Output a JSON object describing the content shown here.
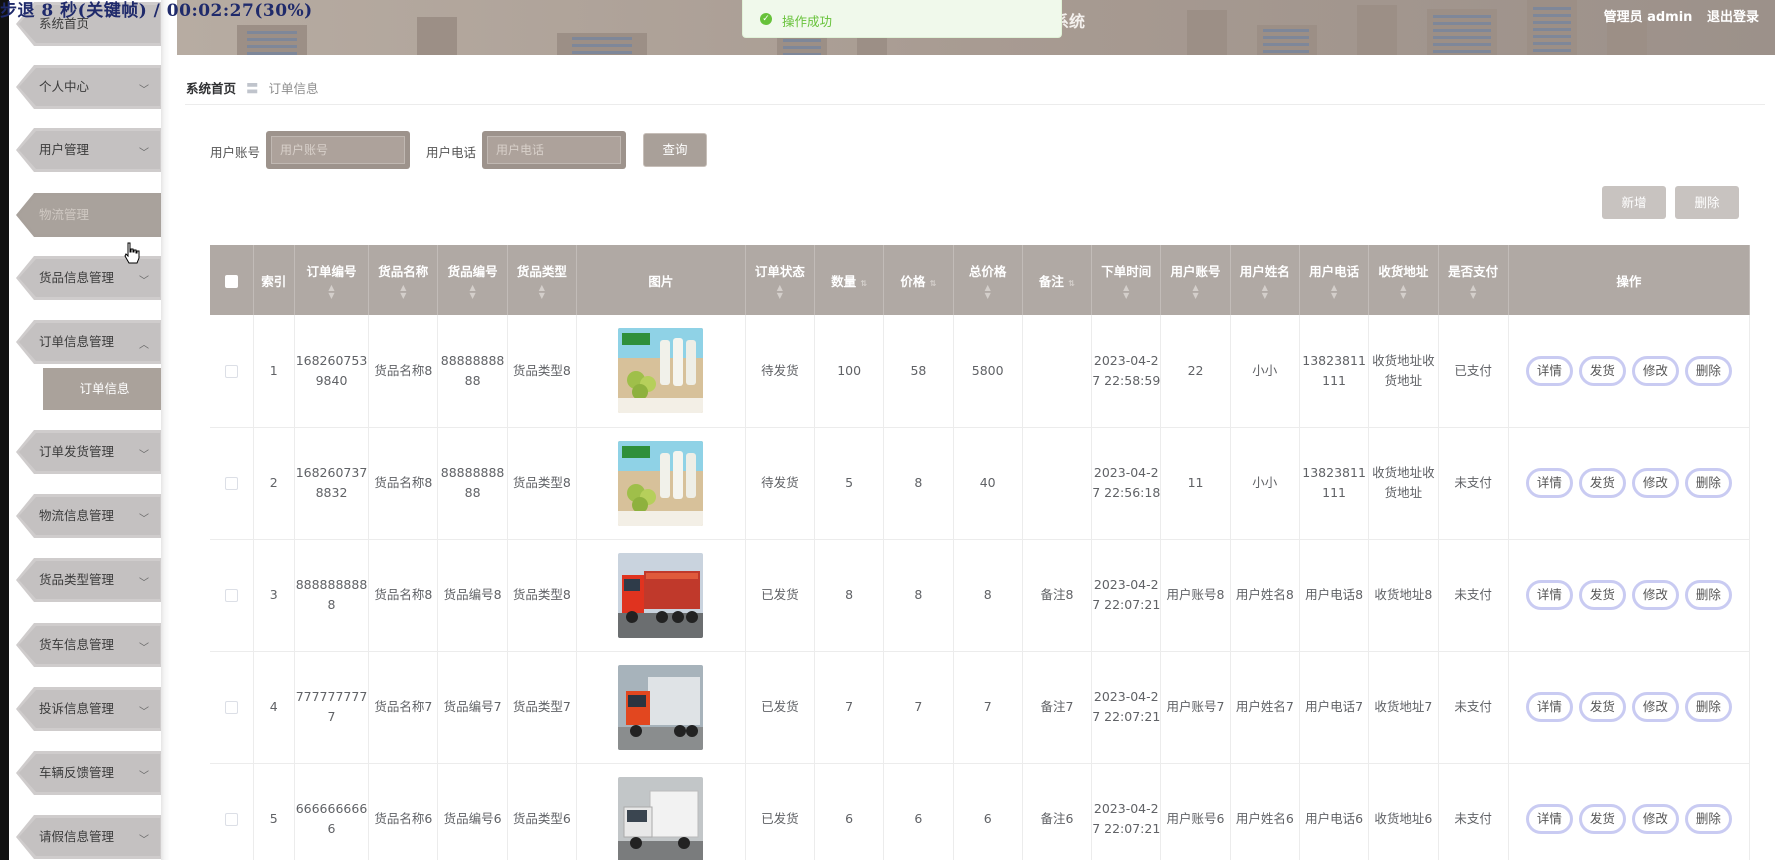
{
  "overlay": {
    "text": "步退 8 秒(关键帧) / 00:02:27(30%)"
  },
  "toast": {
    "message": "操作成功"
  },
  "header": {
    "title": "理系统",
    "user_label": "管理员 admin",
    "logout_label": "退出登录"
  },
  "sidebar": {
    "items": [
      {
        "label": "系统首页"
      },
      {
        "label": "个人中心"
      },
      {
        "label": "用户管理"
      },
      {
        "label": "物流管理"
      },
      {
        "label": "货品信息管理"
      },
      {
        "label": "订单信息管理"
      },
      {
        "label": "订单发货管理"
      },
      {
        "label": "物流信息管理"
      },
      {
        "label": "货品类型管理"
      },
      {
        "label": "货车信息管理"
      },
      {
        "label": "投诉信息管理"
      },
      {
        "label": "车辆反馈管理"
      },
      {
        "label": "请假信息管理"
      }
    ],
    "submenu": {
      "label": "订单信息"
    }
  },
  "breadcrumb": {
    "home": "系统首页",
    "separator": "〓",
    "current": "订单信息"
  },
  "search": {
    "account_label": "用户账号",
    "account_placeholder": "用户账号",
    "phone_label": "用户电话",
    "phone_placeholder": "用户电话",
    "query_label": "查询"
  },
  "actions": {
    "add_label": "新增",
    "delete_label": "删除"
  },
  "table": {
    "columns": [
      "索引",
      "订单编号",
      "货品名称",
      "货品编号",
      "货品类型",
      "图片",
      "订单状态",
      "数量",
      "价格",
      "总价格",
      "备注",
      "下单时间",
      "用户账号",
      "用户姓名",
      "用户电话",
      "收货地址",
      "是否支付",
      "操作"
    ],
    "op_labels": [
      "详情",
      "发货",
      "修改",
      "删除"
    ],
    "rows": [
      {
        "index": "1",
        "order_no": "1682607539840",
        "name": "货品名称8",
        "code": "8888888888",
        "type": "货品类型8",
        "image": "product",
        "status": "待发货",
        "qty": "100",
        "price": "58",
        "total": "5800",
        "remark": "",
        "time": "2023-04-27 22:58:59",
        "account": "22",
        "username": "小小",
        "phone": "13823811111",
        "address": "收货地址收货地址",
        "paid": "已支付"
      },
      {
        "index": "2",
        "order_no": "1682607378832",
        "name": "货品名称8",
        "code": "8888888888",
        "type": "货品类型8",
        "image": "product",
        "status": "待发货",
        "qty": "5",
        "price": "8",
        "total": "40",
        "remark": "",
        "time": "2023-04-27 22:56:18",
        "account": "11",
        "username": "小小",
        "phone": "13823811111",
        "address": "收货地址收货地址",
        "paid": "未支付"
      },
      {
        "index": "3",
        "order_no": "8888888888",
        "name": "货品名称8",
        "code": "货品编号8",
        "type": "货品类型8",
        "image": "red-truck",
        "status": "已发货",
        "qty": "8",
        "price": "8",
        "total": "8",
        "remark": "备注8",
        "time": "2023-04-27 22:07:21",
        "account": "用户账号8",
        "username": "用户姓名8",
        "phone": "用户电话8",
        "address": "收货地址8",
        "paid": "未支付"
      },
      {
        "index": "4",
        "order_no": "7777777777",
        "name": "货品名称7",
        "code": "货品编号7",
        "type": "货品类型7",
        "image": "box-truck",
        "status": "已发货",
        "qty": "7",
        "price": "7",
        "total": "7",
        "remark": "备注7",
        "time": "2023-04-27 22:07:21",
        "account": "用户账号7",
        "username": "用户姓名7",
        "phone": "用户电话7",
        "address": "收货地址7",
        "paid": "未支付"
      },
      {
        "index": "5",
        "order_no": "6666666666",
        "name": "货品名称6",
        "code": "货品编号6",
        "type": "货品类型6",
        "image": "mini-truck",
        "status": "已发货",
        "qty": "6",
        "price": "6",
        "total": "6",
        "remark": "备注6",
        "time": "2023-04-27 22:07:21",
        "account": "用户账号6",
        "username": "用户姓名6",
        "phone": "用户电话6",
        "address": "收货地址6",
        "paid": "未支付"
      }
    ]
  }
}
